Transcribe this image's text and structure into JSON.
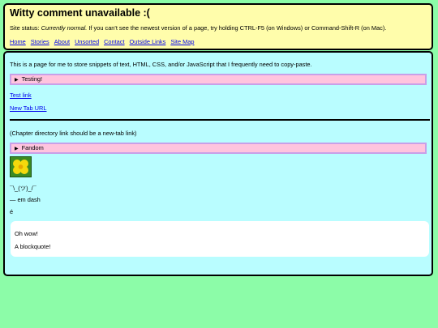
{
  "header": {
    "title": "Witty comment unavailable :(",
    "status_label": "Site status: ",
    "status_value": "Currently normal.",
    "status_note": " If you can't see the newest version of a page, try holding CTRL-F5 (on Windows) or Command-Shift-R (on Mac).",
    "nav": [
      "Home",
      "Stories",
      "About",
      "Unsorted",
      "Contact",
      "Outside Links",
      "Site Map"
    ]
  },
  "main": {
    "intro": "This is a page for me to store snippets of text, HTML, CSS, and/or JavaScript that I frequently need to copy-paste.",
    "details_testing": "Testing!",
    "test_link": "Test link",
    "new_tab_link": "New Tab URL",
    "chapter_note": "(Chapter directory link should be a new-tab link)",
    "details_fandom": "Fandom",
    "shrug": "¯\\_(ツ)_/¯",
    "em_dash": "— em dash",
    "e_acute": "é",
    "quote_lines": [
      "Oh wow!",
      "A blockquote!"
    ]
  },
  "colors": {
    "page_bg": "#8cfca8",
    "header_bg": "#fffdab",
    "main_bg": "#b9fdff",
    "details_bg": "#ffc4de",
    "link": "#0000ee"
  }
}
